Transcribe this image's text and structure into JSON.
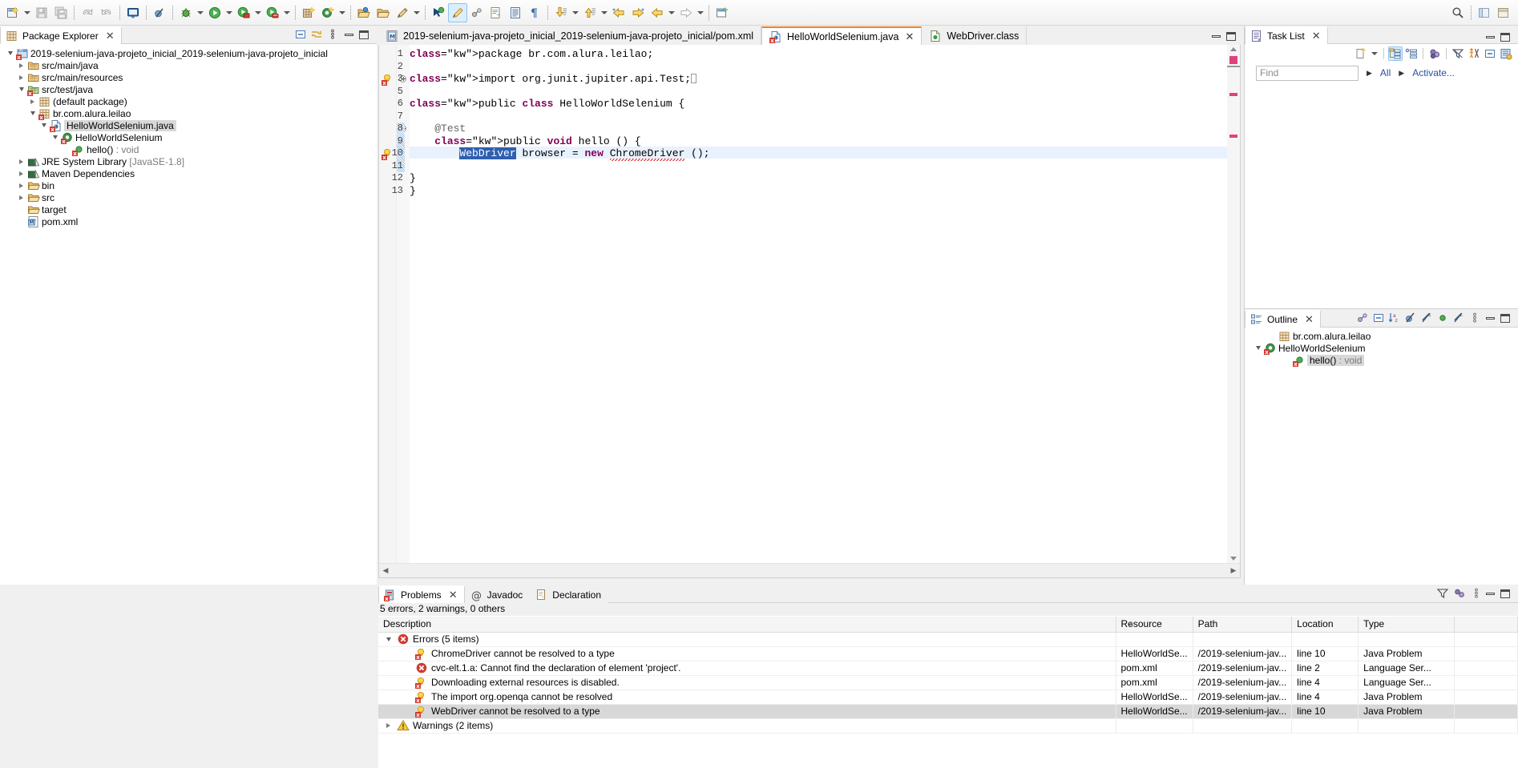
{
  "toolbar": {
    "items": [
      {
        "name": "new-wizard-icon",
        "kind": "icon",
        "glyph": "new"
      },
      {
        "name": "new-wizard-dropdown",
        "kind": "arrow"
      },
      {
        "name": "save-icon",
        "kind": "icon",
        "glyph": "save"
      },
      {
        "name": "save-all-icon",
        "kind": "icon",
        "glyph": "saveall"
      },
      {
        "name": "separator",
        "kind": "sep"
      },
      {
        "name": "undo-icon",
        "kind": "icon",
        "glyph": "undo"
      },
      {
        "name": "redo-icon",
        "kind": "icon",
        "glyph": "redo"
      },
      {
        "name": "separator",
        "kind": "sep"
      },
      {
        "name": "console-icon",
        "kind": "icon",
        "glyph": "console"
      },
      {
        "name": "separator",
        "kind": "sep"
      },
      {
        "name": "skip-breakpoints-icon",
        "kind": "icon",
        "glyph": "skipbp"
      },
      {
        "name": "separator",
        "kind": "sep"
      },
      {
        "name": "debug-icon",
        "kind": "icon",
        "glyph": "debug"
      },
      {
        "name": "debug-dropdown",
        "kind": "arrow"
      },
      {
        "name": "run-icon",
        "kind": "icon",
        "glyph": "run"
      },
      {
        "name": "run-dropdown",
        "kind": "arrow"
      },
      {
        "name": "coverage-icon",
        "kind": "icon",
        "glyph": "coverage"
      },
      {
        "name": "coverage-dropdown",
        "kind": "arrow"
      },
      {
        "name": "run-external-tools-icon",
        "kind": "icon",
        "glyph": "exttools"
      },
      {
        "name": "external-tools-dropdown",
        "kind": "arrow"
      },
      {
        "name": "separator",
        "kind": "sep"
      },
      {
        "name": "new-java-package-icon",
        "kind": "icon",
        "glyph": "pkg"
      },
      {
        "name": "new-java-class-icon",
        "kind": "icon",
        "glyph": "class"
      },
      {
        "name": "class-dropdown",
        "kind": "arrow"
      },
      {
        "name": "separator",
        "kind": "sep"
      },
      {
        "name": "open-type-icon",
        "kind": "icon",
        "glyph": "opentype"
      },
      {
        "name": "open-folder-icon",
        "kind": "icon",
        "glyph": "folder"
      },
      {
        "name": "pencil-icon",
        "kind": "icon",
        "glyph": "pencil"
      },
      {
        "name": "pencil-dropdown",
        "kind": "arrow"
      },
      {
        "name": "separator",
        "kind": "sep"
      },
      {
        "name": "search-type-icon",
        "kind": "icon",
        "glyph": "searchtype"
      },
      {
        "name": "toggle-mark-occurrences-icon",
        "kind": "icon",
        "glyph": "marker",
        "active": true
      },
      {
        "name": "link-icon",
        "kind": "icon",
        "glyph": "linkwith"
      },
      {
        "name": "open-task-icon",
        "kind": "icon",
        "glyph": "opentask"
      },
      {
        "name": "show-whitespace-icon",
        "kind": "icon",
        "glyph": "whitespace"
      },
      {
        "name": "pilcrow-icon",
        "kind": "icon",
        "glyph": "pilcrow"
      },
      {
        "name": "separator",
        "kind": "sep"
      },
      {
        "name": "next-annotation-icon",
        "kind": "icon",
        "glyph": "nextann"
      },
      {
        "name": "next-annotation-dropdown",
        "kind": "arrow"
      },
      {
        "name": "previous-annotation-icon",
        "kind": "icon",
        "glyph": "prevann"
      },
      {
        "name": "previous-annotation-dropdown",
        "kind": "arrow"
      },
      {
        "name": "back-icon",
        "kind": "icon",
        "glyph": "back"
      },
      {
        "name": "forward-icon",
        "kind": "icon",
        "glyph": "forward"
      },
      {
        "name": "prev-edit-icon",
        "kind": "icon",
        "glyph": "prevedit"
      },
      {
        "name": "prev-edit-dropdown",
        "kind": "arrow"
      },
      {
        "name": "next-edit-icon",
        "kind": "icon",
        "glyph": "nextedit"
      },
      {
        "name": "next-edit-dropdown",
        "kind": "arrow"
      },
      {
        "name": "hardsep",
        "kind": "hardsep"
      },
      {
        "name": "new-window-icon",
        "kind": "icon",
        "glyph": "newwin"
      }
    ],
    "right": [
      {
        "name": "search-icon",
        "glyph": "magnifier"
      },
      {
        "name": "perspective-java-icon",
        "glyph": "persp-java"
      },
      {
        "name": "perspective-debug-icon",
        "glyph": "persp-debug"
      }
    ]
  },
  "package_explorer": {
    "tab_label": "Package Explorer",
    "close_label": "✕",
    "tools": [
      "collapse-all-icon",
      "link-with-editor-icon",
      "view-menu-icon",
      "minimize-icon",
      "maximize-icon"
    ],
    "tree": [
      {
        "label": "2019-selenium-java-projeto_inicial_2019-selenium-java-projeto_inicial",
        "indent": 0,
        "twist": "open",
        "icon": "project-error",
        "selected": false
      },
      {
        "label": "src/main/java",
        "indent": 1,
        "twist": "closed",
        "icon": "srcfolder",
        "selected": false
      },
      {
        "label": "src/main/resources",
        "indent": 1,
        "twist": "closed",
        "icon": "srcfolder",
        "selected": false
      },
      {
        "label": "src/test/java",
        "indent": 1,
        "twist": "open",
        "icon": "srcfolder-test-error",
        "selected": false
      },
      {
        "label": "(default package)",
        "indent": 2,
        "twist": "closed",
        "icon": "package",
        "selected": false
      },
      {
        "label": "br.com.alura.leilao",
        "indent": 2,
        "twist": "open",
        "icon": "package-error",
        "selected": false
      },
      {
        "label": "HelloWorldSelenium.java",
        "indent": 3,
        "twist": "open",
        "icon": "javafile-error",
        "selected": true
      },
      {
        "label": "HelloWorldSelenium",
        "indent": 4,
        "twist": "open",
        "icon": "class-error",
        "selected": false
      },
      {
        "label": "hello() : void",
        "indent": 5,
        "twist": "none",
        "icon": "method-error",
        "selected": false
      },
      {
        "label": "JRE System Library",
        "suffix": "[JavaSE-1.8]",
        "indent": 1,
        "twist": "closed",
        "icon": "library",
        "selected": false
      },
      {
        "label": "Maven Dependencies",
        "indent": 1,
        "twist": "closed",
        "icon": "library",
        "selected": false
      },
      {
        "label": "bin",
        "indent": 1,
        "twist": "closed",
        "icon": "folder",
        "selected": false
      },
      {
        "label": "src",
        "indent": 1,
        "twist": "closed",
        "icon": "folder",
        "selected": false
      },
      {
        "label": "target",
        "indent": 1,
        "twist": "none",
        "icon": "folder",
        "selected": false
      },
      {
        "label": "pom.xml",
        "indent": 1,
        "twist": "none",
        "icon": "maven",
        "selected": false
      }
    ]
  },
  "editor": {
    "tabs": [
      {
        "label": "2019-selenium-java-projeto_inicial_2019-selenium-java-projeto_inicial/pom.xml",
        "icon": "maven-file-icon",
        "active": false,
        "closable": false
      },
      {
        "label": "HelloWorldSelenium.java",
        "icon": "java-file-error-icon",
        "active": true,
        "closable": true,
        "close_label": "✕"
      },
      {
        "label": "WebDriver.class",
        "icon": "class-file-icon",
        "active": false,
        "closable": false
      }
    ],
    "minimize_label": "–",
    "maximize_label": "□",
    "lines": [
      {
        "no": "1",
        "gutter": "",
        "marker": "",
        "text": "package br.com.alura.leilao;"
      },
      {
        "no": "2",
        "gutter": "",
        "marker": "",
        "text": ""
      },
      {
        "no": "3",
        "gutter": "warn-error",
        "marker": "collapse-plus",
        "text": "import org.junit.jupiter.api.Test;"
      },
      {
        "no": "5",
        "gutter": "",
        "marker": "",
        "text": ""
      },
      {
        "no": "6",
        "gutter": "",
        "marker": "",
        "text": "public class HelloWorldSelenium {"
      },
      {
        "no": "7",
        "gutter": "",
        "marker": "",
        "text": ""
      },
      {
        "no": "8",
        "gutter": "",
        "marker": "collapse-minus",
        "text": "    @Test"
      },
      {
        "no": "9",
        "gutter": "",
        "marker": "",
        "text": "    public void hello () {"
      },
      {
        "no": "10",
        "gutter": "warn-error",
        "marker": "",
        "text": "        WebDriver browser = new ChromeDriver ();"
      },
      {
        "no": "11",
        "gutter": "",
        "marker": "",
        "text": ""
      },
      {
        "no": "12",
        "gutter": "",
        "marker": "",
        "text": "}"
      },
      {
        "no": "13",
        "gutter": "",
        "marker": "",
        "text": "}"
      }
    ],
    "selected_token": "WebDriver",
    "error_token": "ChromeDriver",
    "highlight_line_no": "10"
  },
  "task_list": {
    "tab_label": "Task List",
    "close_label": "✕",
    "tools": [
      "new-task-icon",
      "new-task-dropdown",
      "categorize-icon",
      "flat-presentation-icon",
      "focus-icon",
      "filter-icon",
      "working-sets-icon",
      "collapse-all-icon",
      "view-menu-icon"
    ],
    "find_placeholder": "Find",
    "all_label": "All",
    "activate_label": "Activate...",
    "minimize_label": "–",
    "maximize_label": "□"
  },
  "outline": {
    "tab_label": "Outline",
    "close_label": "✕",
    "tools": [
      "link-icon",
      "collapse-all-icon",
      "sort-icon",
      "hide-fields-icon",
      "hide-static-icon",
      "hide-nonpublic-icon",
      "hide-local-icon",
      "view-menu-icon"
    ],
    "minimize_label": "–",
    "maximize_label": "□",
    "tree": [
      {
        "label": "br.com.alura.leilao",
        "indent": 1,
        "twist": "none",
        "icon": "package",
        "selected": false
      },
      {
        "label": "HelloWorldSelenium",
        "indent": 0,
        "twist": "open",
        "icon": "class-error",
        "selected": false
      },
      {
        "label": "hello() : void",
        "indent": 2,
        "twist": "none",
        "icon": "method-error",
        "selected": true
      }
    ]
  },
  "problems": {
    "tabs": [
      {
        "label": "Problems",
        "icon": "problems-icon",
        "active": true,
        "closable": true,
        "close_label": "✕"
      },
      {
        "label": "Javadoc",
        "icon": "javadoc-icon",
        "active": false,
        "closable": false
      },
      {
        "label": "Declaration",
        "icon": "declaration-icon",
        "active": false,
        "closable": false
      }
    ],
    "summary": "5 errors, 2 warnings, 0 others",
    "tools": [
      "filter-icon",
      "focus-icon",
      "view-menu-icon",
      "minimize-icon",
      "maximize-icon"
    ],
    "columns": [
      "Description",
      "Resource",
      "Path",
      "Location",
      "Type"
    ],
    "rows": [
      {
        "type": "group",
        "twist": "open",
        "icon": "error-icon",
        "description": "Errors (5 items)",
        "resource": "",
        "path": "",
        "location": "",
        "ptype": "",
        "selected": false
      },
      {
        "type": "item",
        "icon": "error-marker-icon",
        "description": "ChromeDriver cannot be resolved to a type",
        "resource": "HelloWorldSe...",
        "path": "/2019-selenium-jav...",
        "location": "line 10",
        "ptype": "Java Problem",
        "selected": false
      },
      {
        "type": "item",
        "icon": "error-icon",
        "description": "cvc-elt.1.a: Cannot find the declaration of element 'project'.",
        "resource": "pom.xml",
        "path": "/2019-selenium-jav...",
        "location": "line 2",
        "ptype": "Language Ser...",
        "selected": false
      },
      {
        "type": "item",
        "icon": "error-marker-icon",
        "description": "Downloading external resources is disabled.",
        "resource": "pom.xml",
        "path": "/2019-selenium-jav...",
        "location": "line 4",
        "ptype": "Language Ser...",
        "selected": false
      },
      {
        "type": "item",
        "icon": "error-marker-icon",
        "description": "The import org.openqa cannot be resolved",
        "resource": "HelloWorldSe...",
        "path": "/2019-selenium-jav...",
        "location": "line 4",
        "ptype": "Java Problem",
        "selected": false
      },
      {
        "type": "item",
        "icon": "error-marker-icon",
        "description": "WebDriver cannot be resolved to a type",
        "resource": "HelloWorldSe...",
        "path": "/2019-selenium-jav...",
        "location": "line 10",
        "ptype": "Java Problem",
        "selected": true
      },
      {
        "type": "group",
        "twist": "closed",
        "icon": "warning-icon",
        "description": "Warnings (2 items)",
        "resource": "",
        "path": "",
        "location": "",
        "ptype": "",
        "selected": false
      }
    ]
  },
  "colors": {
    "accent_tab": "#f58220",
    "keyword": "#7f0055",
    "selection": "#2f5fb0",
    "error_red": "#d23b2f",
    "warning_yellow": "#f6c000",
    "line_highlight": "#e8f2fe",
    "link": "#2a4fa2"
  }
}
